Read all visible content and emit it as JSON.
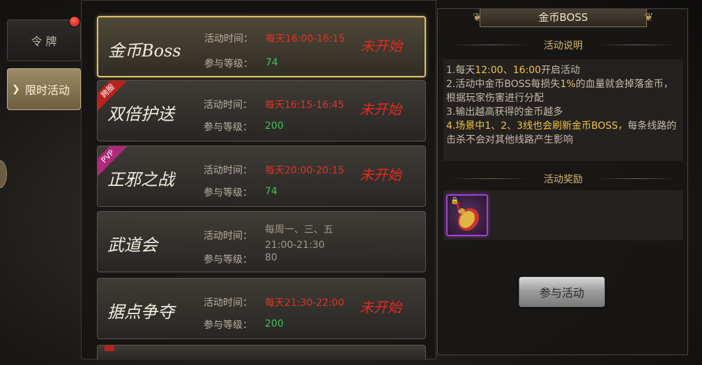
{
  "sidebar": {
    "tabs": [
      {
        "label": "令 牌"
      },
      {
        "label": "限时活动"
      }
    ]
  },
  "activities": [
    {
      "name": "金币Boss",
      "time_label": "活动时间：",
      "time": "每天16:00-16:15",
      "level_label": "参与等级：",
      "level": "74",
      "status": "未开始",
      "badge": ""
    },
    {
      "name": "双倍护送",
      "time_label": "活动时间：",
      "time": "每天16:15-16:45",
      "level_label": "参与等级：",
      "level": "200",
      "status": "未开始",
      "badge": "跨服"
    },
    {
      "name": "正邪之战",
      "time_label": "活动时间：",
      "time": "每天20:00-20:15",
      "level_label": "参与等级：",
      "level": "74",
      "status": "未开始",
      "badge": "PVP"
    },
    {
      "name": "武道会",
      "time_label": "活动时间：",
      "time_line1": "每周一、三、五",
      "time_line2": "21:00-21:30",
      "level_label": "参与等级：",
      "level": "80",
      "status": "",
      "badge": ""
    },
    {
      "name": "据点争夺",
      "time_label": "活动时间：",
      "time": "每天21:30-22:00",
      "level_label": "参与等级：",
      "level": "200",
      "status": "未开始",
      "badge": ""
    }
  ],
  "detail": {
    "title": "金币BOSS",
    "desc_heading": "活动说明",
    "desc": {
      "l1_a": "1.每天",
      "l1_b": "12:00、16:00",
      "l1_c": "开启活动",
      "l2_a": "2.活动中金币BOSS每损失",
      "l2_b": "1%",
      "l2_c": "的血量就会掉落金币，根据玩家伤害进行分配",
      "l3": "3.输出越高获得的金币越多",
      "l4_a": "4.场景中1、2、3线也会刷新金币BOSS，",
      "l4_b": "每条线路的击杀不会对其他线路产生影响"
    },
    "reward_heading": "活动奖励",
    "join_label": "参与活动"
  },
  "colors": {
    "time_red": "#e0332a",
    "level_green": "#3fc65a",
    "highlight_gold": "#f0c542",
    "selected_border": "#e2c26d"
  },
  "icons": [
    "lock-icon",
    "gold-coin-pouch-icon"
  ]
}
